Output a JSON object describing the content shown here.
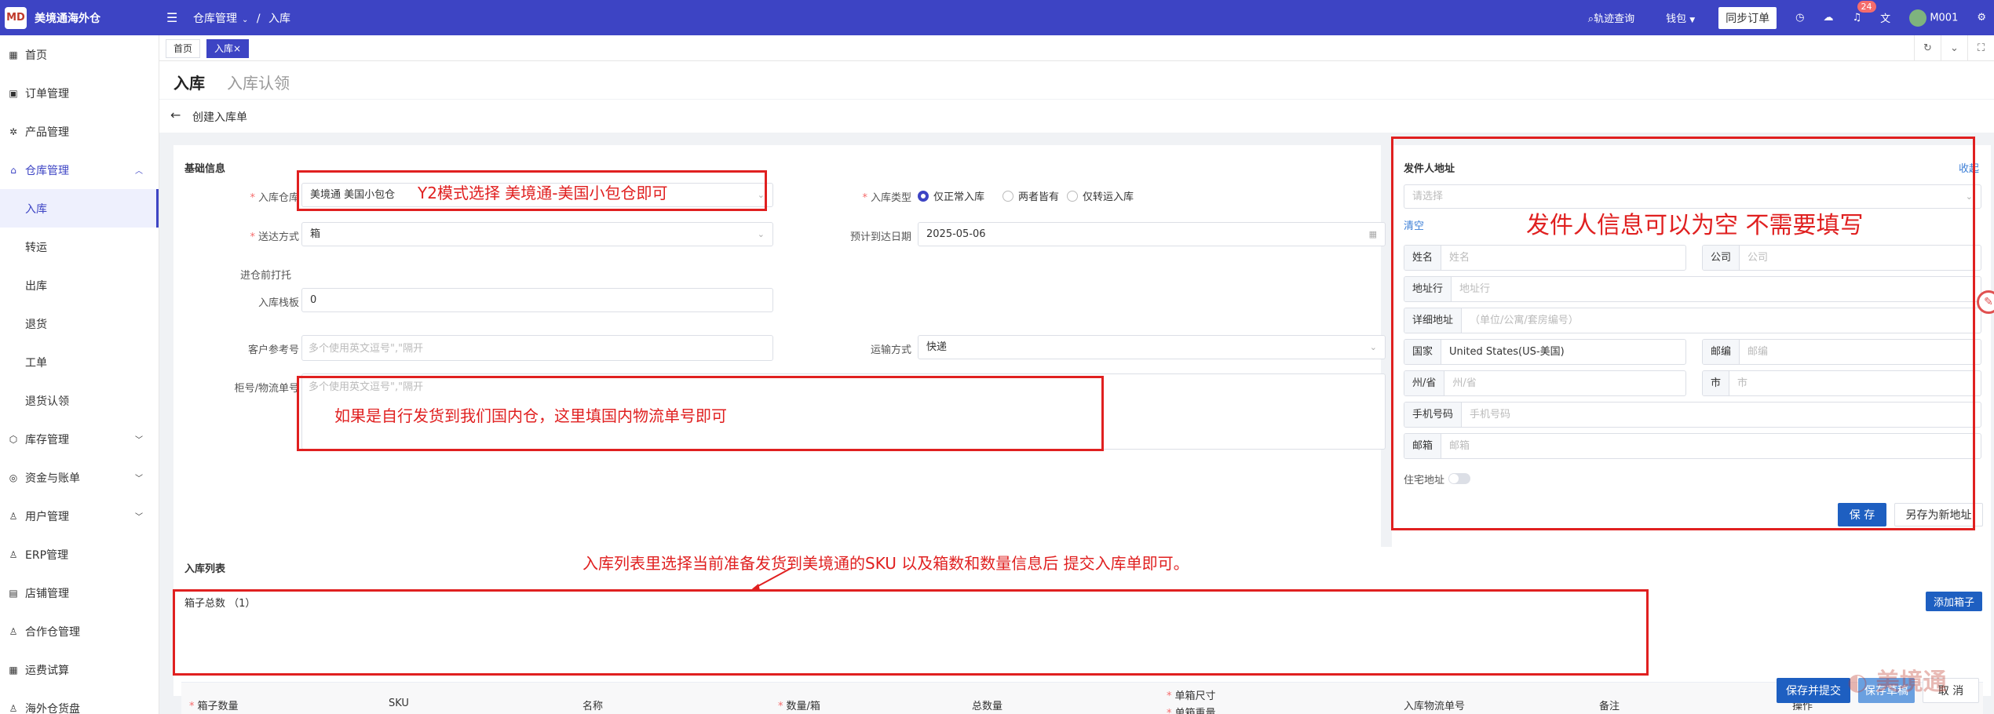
{
  "app": {
    "title": "美境通海外仓",
    "logo_text": "MD"
  },
  "header": {
    "breadcrumb": [
      "仓库管理",
      "入库"
    ],
    "track_query": "轨迹查询",
    "wallet": "钱包",
    "sync_order": "同步订单",
    "notification_count": "24",
    "user": "M001"
  },
  "sidebar": {
    "items": [
      {
        "label": "首页",
        "icon": "grid-icon"
      },
      {
        "label": "订单管理",
        "icon": "order-icon"
      },
      {
        "label": "产品管理",
        "icon": "gear-icon"
      },
      {
        "label": "仓库管理",
        "icon": "warehouse-icon",
        "open": true
      },
      {
        "label": "入库",
        "sub": true,
        "active": true
      },
      {
        "label": "转运",
        "sub": true
      },
      {
        "label": "出库",
        "sub": true
      },
      {
        "label": "退货",
        "sub": true
      },
      {
        "label": "工单",
        "sub": true
      },
      {
        "label": "退货认领",
        "sub": true
      },
      {
        "label": "库存管理",
        "icon": "box-icon"
      },
      {
        "label": "资金与账单",
        "icon": "money-icon"
      },
      {
        "label": "用户管理",
        "icon": "user-icon"
      },
      {
        "label": "ERP管理",
        "icon": "user-icon"
      },
      {
        "label": "店铺管理",
        "icon": "shop-icon"
      },
      {
        "label": "合作仓管理",
        "icon": "user-icon"
      },
      {
        "label": "运费试算",
        "icon": "calc-icon"
      },
      {
        "label": "海外仓货盘",
        "icon": "user-icon"
      }
    ]
  },
  "tabs": [
    {
      "label": "首页"
    },
    {
      "label": "入库×"
    }
  ],
  "page": {
    "title": "入库",
    "alt_title": "入库认领",
    "back_label": "创建入库单"
  },
  "basic": {
    "section_title": "基础信息",
    "warehouse_label": "入库仓库",
    "warehouse_value": "美境通 美国小包仓",
    "inbound_type_label": "入库类型",
    "inbound_types": [
      "仅正常入库",
      "两者皆有",
      "仅转运入库"
    ],
    "delivery_label": "送达方式",
    "delivery_value": "箱",
    "eta_label": "预计到达日期",
    "eta_value": "2025-05-06",
    "pallet_label": "进仓前打托",
    "pallet_count_label": "入库栈板",
    "pallet_count_value": "0",
    "customer_ref_label": "客户参考号",
    "customer_ref_placeholder": "多个使用英文逗号\",\"隔开",
    "transport_label": "运输方式",
    "transport_value": "快递",
    "tracking_label": "柜号/物流单号",
    "tracking_placeholder": "多个使用英文逗号\",\"隔开"
  },
  "sender": {
    "section_title": "发件人地址",
    "collapse": "收起",
    "select_placeholder": "请选择",
    "clear": "清空",
    "name_label": "姓名",
    "name_ph": "姓名",
    "company_label": "公司",
    "company_ph": "公司",
    "addr_label": "地址行",
    "addr_ph": "地址行",
    "detail_label": "详细地址",
    "detail_ph": "（单位/公寓/套房编号）",
    "country_label": "国家",
    "country_value": "United States(US-美国)",
    "zip_label": "邮编",
    "zip_ph": "邮编",
    "state_label": "州/省",
    "state_ph": "州/省",
    "city_label": "市",
    "city_ph": "市",
    "phone_label": "手机号码",
    "phone_ph": "手机号码",
    "email_label": "邮箱",
    "email_ph": "邮箱",
    "residential_label": "住宅地址",
    "save": "保 存",
    "save_new": "另存为新地址"
  },
  "list": {
    "section_title": "入库列表",
    "box_total": "箱子总数 （1）",
    "add_box": "添加箱子",
    "columns": [
      "箱子数量",
      "SKU",
      "名称",
      "数量/箱",
      "总数量",
      "单箱尺寸",
      "单箱重量",
      "入库物流单号",
      "备注",
      "操作"
    ]
  },
  "footer": {
    "submit": "保存并提交",
    "save": "保存草稿",
    "cancel": "取 消"
  },
  "annotations": {
    "warehouse": "Y2模式选择 美境通-美国小包仓即可",
    "tracking": "如果是自行发货到我们国内仓，这里填国内物流单号即可",
    "sender": "发件人信息可以为空 不需要填写",
    "list": "入库列表里选择当前准备发货到美境通的SKU 以及箱数和数量信息后 提交入库单即可。"
  },
  "watermark": "美境通",
  "colors": {
    "brand": "#3d44c4",
    "annotation": "#e02020",
    "primary_button": "#1e5fc1"
  }
}
